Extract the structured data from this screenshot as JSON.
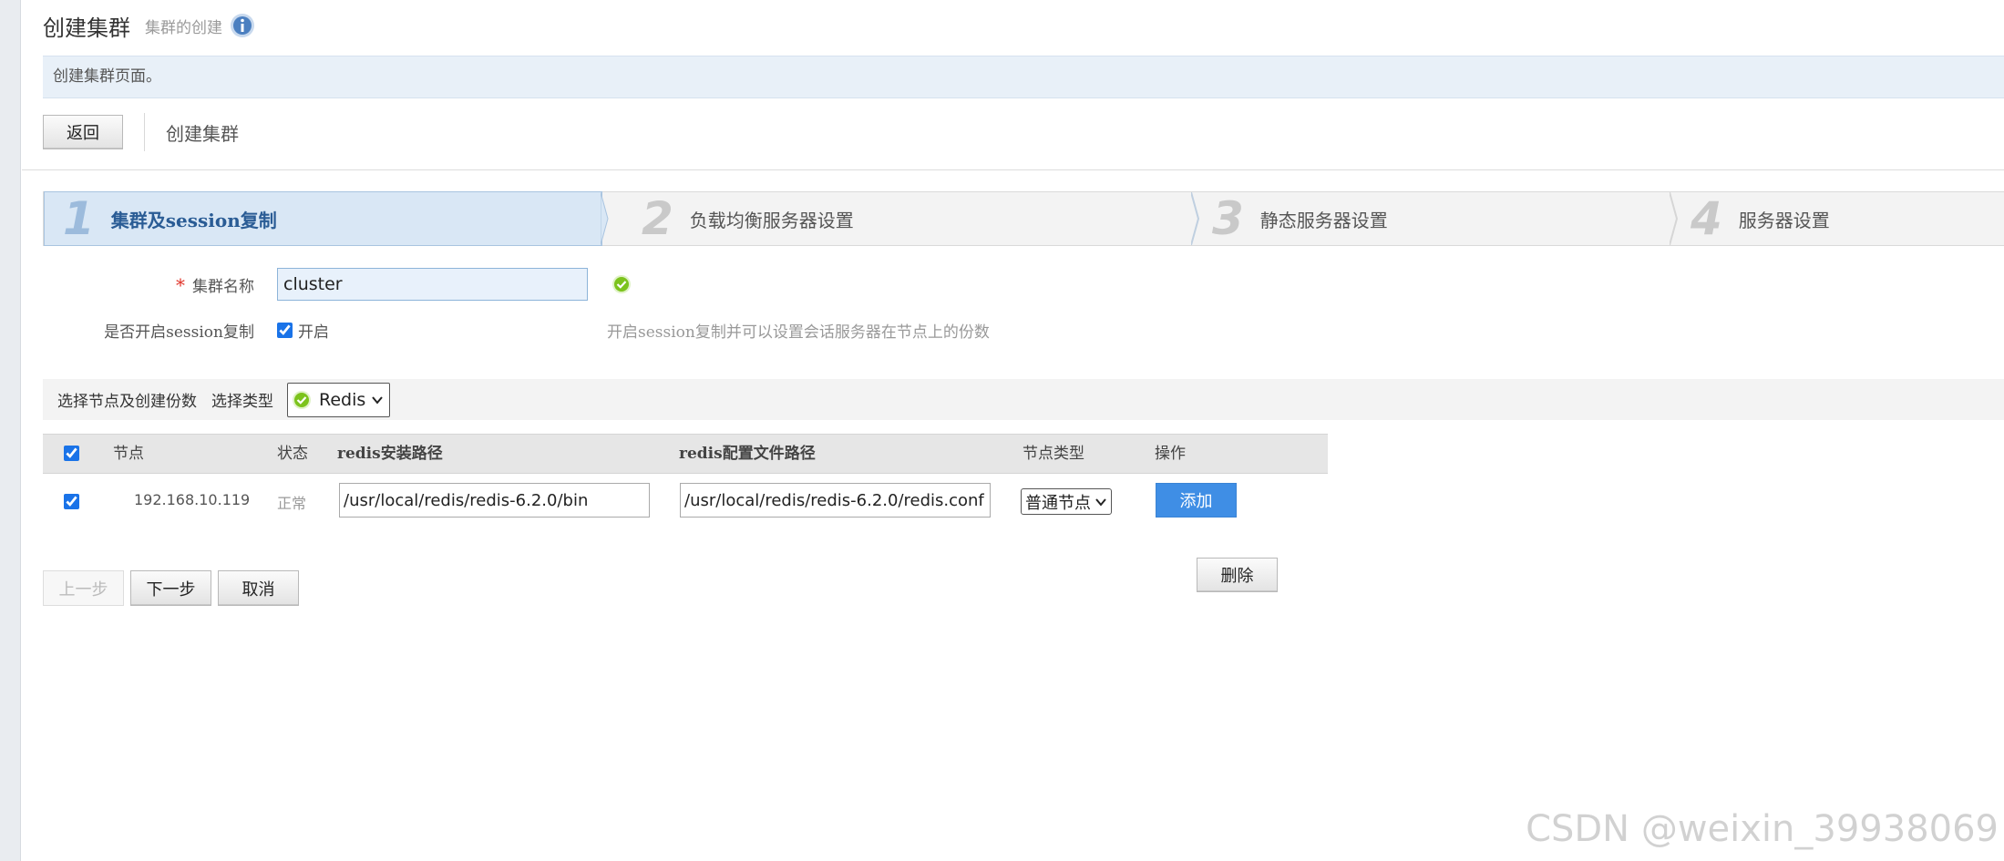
{
  "header": {
    "title": "创建集群",
    "subtitle": "集群的创建",
    "notice": "创建集群页面。"
  },
  "toolbar": {
    "back_label": "返回",
    "section_title": "创建集群"
  },
  "steps": [
    {
      "num": "1",
      "label": "集群及session复制",
      "active": true
    },
    {
      "num": "2",
      "label": "负载均衡服务器设置",
      "active": false
    },
    {
      "num": "3",
      "label": "静态服务器设置",
      "active": false
    },
    {
      "num": "4",
      "label": "服务器设置",
      "active": false
    }
  ],
  "form": {
    "cluster_name_label": "集群名称",
    "cluster_name_value": "cluster",
    "session_label": "是否开启session复制",
    "session_checkbox_label": "开启",
    "session_checked": true,
    "session_hint": "开启session复制并可以设置会话服务器在节点上的份数"
  },
  "section": {
    "title": "选择节点及创建份数",
    "type_label": "选择类型",
    "type_value": "Redis"
  },
  "table": {
    "columns": [
      "节点",
      "状态",
      "redis安装路径",
      "redis配置文件路径",
      "节点类型",
      "操作"
    ],
    "rows": [
      {
        "checked": true,
        "node": "192.168.10.119",
        "status": "正常",
        "install_path": "/usr/local/redis/redis-6.2.0/bin",
        "config_path": "/usr/local/redis/redis-6.2.0/redis.conf",
        "node_type": "普通节点",
        "add_label": "添加",
        "delete_label": "删除"
      }
    ]
  },
  "nav": {
    "prev_label": "上一步",
    "next_label": "下一步",
    "cancel_label": "取消"
  },
  "watermark": "CSDN @weixin_39938069",
  "colors": {
    "accent": "#3f8ee5",
    "active_step_bg": "#d9e7f5",
    "success": "#7cc31c",
    "required": "#e0342a"
  }
}
